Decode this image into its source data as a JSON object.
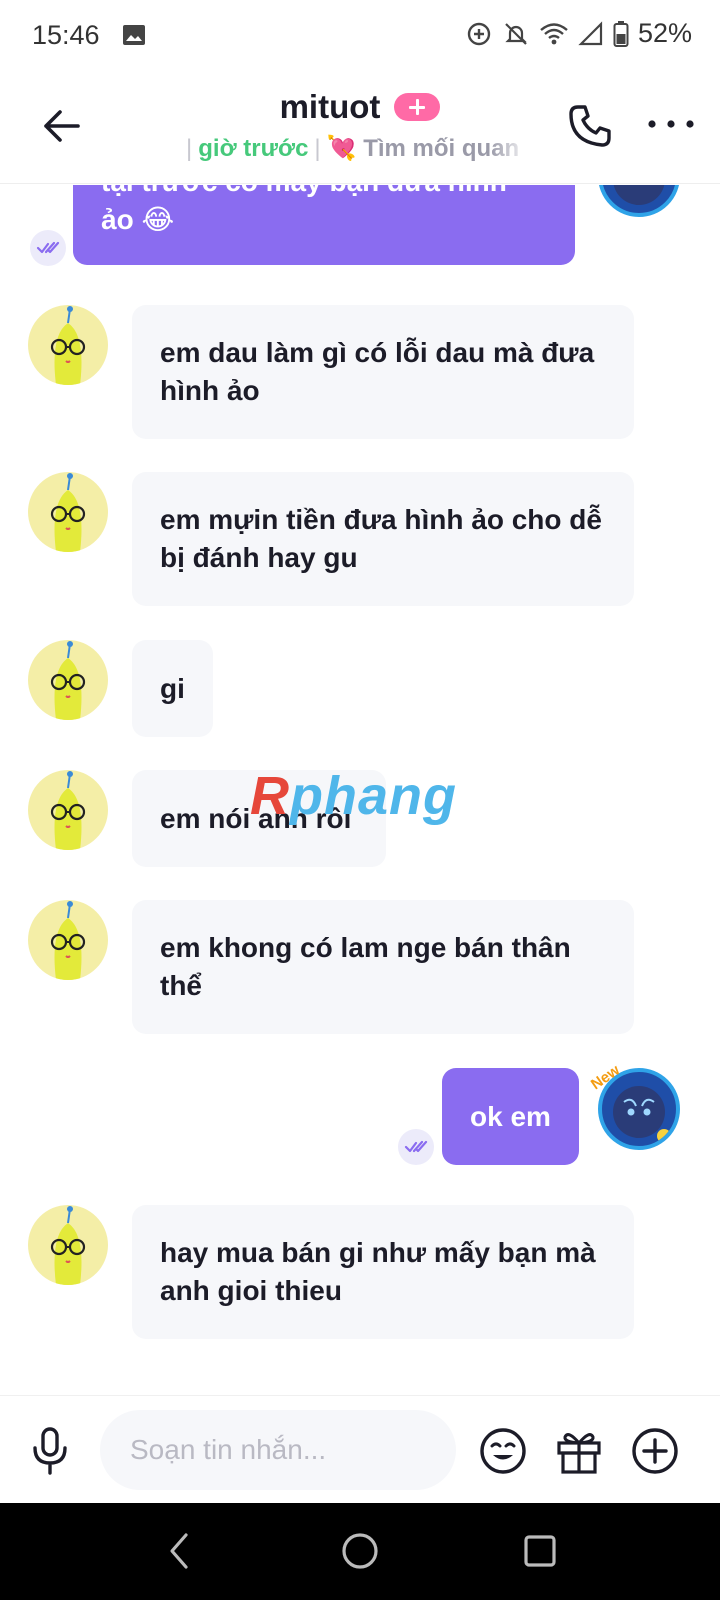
{
  "status_bar": {
    "time": "15:46",
    "battery": "52%",
    "icons": [
      "image-icon",
      "data-saver-icon",
      "bell-off-icon",
      "wifi-icon",
      "signal-icon",
      "battery-icon"
    ]
  },
  "header": {
    "contact_name": "mituot",
    "last_seen": "giờ trước",
    "relationship": "💘 Tìm mối quan",
    "colors": {
      "online_green": "#46c97b",
      "plus_pink": "#ff6aa6"
    }
  },
  "chat": {
    "colors": {
      "outgoing_bubble": "#8a6cf0",
      "incoming_bubble": "#f6f7fa"
    },
    "messages": [
      {
        "direction": "out",
        "text": "tại trước có mấy bạn đưa hình ảo 😂"
      },
      {
        "direction": "in",
        "text": "em dau làm gì có lỗi dau mà đưa hình ảo"
      },
      {
        "direction": "in",
        "text": "em mựin tiền đưa hình ảo cho dễ bị đánh hay gu"
      },
      {
        "direction": "in",
        "text": "gi"
      },
      {
        "direction": "in",
        "text": "em nói anh rồi"
      },
      {
        "direction": "in",
        "text": "em khong có lam nge bán thân thể"
      },
      {
        "direction": "out",
        "text": "ok em"
      },
      {
        "direction": "in",
        "text": "hay mua bán gi như mấy bạn mà anh gioi thieu"
      }
    ],
    "my_avatar_badge": "New"
  },
  "watermark": {
    "first": "R",
    "rest": "phang"
  },
  "composer": {
    "placeholder": "Soạn tin nhắn...",
    "value": ""
  }
}
